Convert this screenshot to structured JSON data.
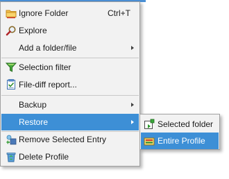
{
  "menu": {
    "items": [
      {
        "id": "ignore-folder",
        "label": "Ignore Folder",
        "shortcut": "Ctrl+T",
        "icon": "folder-icon"
      },
      {
        "id": "explore",
        "label": "Explore",
        "icon": "magnifier-icon"
      },
      {
        "id": "add-folder-file",
        "label": "Add a folder/file",
        "has_submenu": true
      },
      {
        "id": "selection-filter",
        "label": "Selection filter",
        "icon": "filter-icon"
      },
      {
        "id": "file-diff-report",
        "label": "File-diff report...",
        "icon": "report-icon"
      },
      {
        "id": "backup",
        "label": "Backup",
        "has_submenu": true
      },
      {
        "id": "restore",
        "label": "Restore",
        "has_submenu": true,
        "highlighted": true
      },
      {
        "id": "remove-selected-entry",
        "label": "Remove Selected Entry",
        "icon": "remove-entry-icon"
      },
      {
        "id": "delete-profile",
        "label": "Delete Profile",
        "icon": "recycle-bin-icon"
      }
    ]
  },
  "submenu": {
    "items": [
      {
        "id": "selected-folder",
        "label": "Selected folder",
        "icon": "restore-folder-icon"
      },
      {
        "id": "entire-profile",
        "label": "Entire Profile",
        "icon": "restore-profile-icon",
        "highlighted": true
      }
    ]
  },
  "colors": {
    "menu_background": "#f2f2f2",
    "highlight": "#3d8fd6",
    "separator": "#c8c8c8",
    "border": "#a0a0a0"
  }
}
